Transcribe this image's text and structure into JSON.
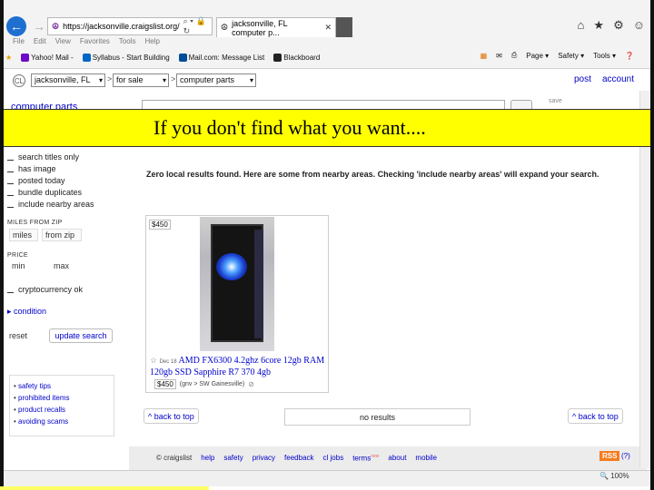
{
  "browser": {
    "address": "https://jacksonville.craigslist.org/",
    "tab_title": "jacksonville, FL computer p...",
    "menu": [
      "File",
      "Edit",
      "View",
      "Favorites",
      "Tools",
      "Help"
    ],
    "favorites": [
      "Yahoo! Mail -",
      "Syllabus - Start Building",
      "Mail.com: Message List",
      "Blackboard"
    ],
    "command_bar": [
      "Page ▾",
      "Safety ▾",
      "Tools ▾"
    ],
    "zoom": "100%"
  },
  "header": {
    "location": "jacksonville, FL",
    "section": "for sale",
    "category": "computer parts",
    "post_link": "post",
    "account_link": "account",
    "save": "save"
  },
  "page": {
    "category_title": "computer parts"
  },
  "banner": {
    "text": "If you don't find what you want...."
  },
  "sidebar": {
    "checkboxes_top": [
      "search titles only",
      "has image",
      "posted today",
      "bundle duplicates",
      "include nearby areas"
    ],
    "miles_label": "MILES FROM ZIP",
    "miles_placeholder": "miles",
    "zip_placeholder": "from zip",
    "price_label": "PRICE",
    "min_placeholder": "min",
    "max_placeholder": "max",
    "crypto": "cryptocurrency ok",
    "condition": "condition",
    "reset": "reset",
    "update": "update search",
    "links": [
      "safety tips",
      "prohibited items",
      "product recalls",
      "avoiding scams"
    ]
  },
  "results": {
    "notice": "Zero local results found. Here are some from nearby areas. Checking 'include nearby areas' will expand your search.",
    "listing": {
      "price_badge": "$450",
      "date": "Dec 18",
      "title": "AMD FX6300 4.2ghz 6core 12gb RAM 120gb SSD Sapphire R7 370 4gb",
      "price": "$450",
      "location": "(gnv > SW Gainesville)"
    },
    "back_to_top": "^ back to top",
    "no_results": "no results"
  },
  "footer": {
    "links": [
      "© craigslist",
      "help",
      "safety",
      "privacy",
      "feedback",
      "cl jobs",
      "terms",
      "about",
      "mobile"
    ],
    "new_badge": "new",
    "rss": "RSS",
    "help_q": "(?)"
  }
}
